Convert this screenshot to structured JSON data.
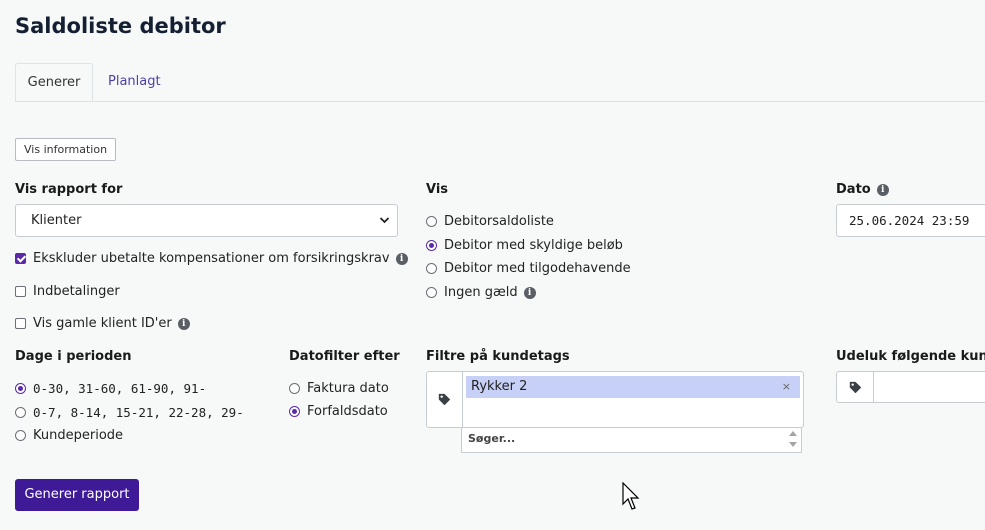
{
  "page": {
    "title": "Saldoliste debitor"
  },
  "tabs": [
    {
      "label": "Generer",
      "active": true
    },
    {
      "label": "Planlagt",
      "active": false
    }
  ],
  "info_button": {
    "label": "Vis information"
  },
  "report_for": {
    "label": "Vis rapport for",
    "selected": "Klienter",
    "options": [
      {
        "label": "Ekskluder ubetalte kompensationer om forsikringskrav",
        "checked": true,
        "info": true
      },
      {
        "label": "Indbetalinger",
        "checked": false,
        "info": false
      },
      {
        "label": "Vis gamle klient ID'er",
        "checked": false,
        "info": true
      }
    ]
  },
  "vis": {
    "label": "Vis",
    "options": [
      {
        "label": "Debitorsaldoliste",
        "checked": false,
        "info": false
      },
      {
        "label": "Debitor med skyldige beløb",
        "checked": true,
        "info": false
      },
      {
        "label": "Debitor med tilgodehavende",
        "checked": false,
        "info": false
      },
      {
        "label": "Ingen gæld",
        "checked": false,
        "info": true
      }
    ]
  },
  "dato": {
    "label": "Dato",
    "value": "25.06.2024 23:59"
  },
  "dage": {
    "label": "Dage i perioden",
    "options": [
      {
        "label": "0-30, 31-60, 61-90, 91-",
        "checked": true
      },
      {
        "label": "0-7, 8-14, 15-21, 22-28, 29-",
        "checked": false
      },
      {
        "label": "Kundeperiode",
        "checked": false
      }
    ]
  },
  "datofilter": {
    "label": "Datofilter efter",
    "options": [
      {
        "label": "Faktura dato",
        "checked": false
      },
      {
        "label": "Forfaldsdato",
        "checked": true
      }
    ]
  },
  "kundetags": {
    "label": "Filtre på kundetags",
    "selected_tag": "Rykker 2",
    "remove_symbol": "×",
    "search_placeholder": "Søger..."
  },
  "udeluk": {
    "label": "Udeluk følgende kundet"
  },
  "submit": {
    "label": "Generer rapport"
  },
  "icons": {
    "info": "info-icon",
    "tag": "tag-icon",
    "chevron": "chevron-down-icon",
    "cursor": "mouse-cursor-icon"
  },
  "colors": {
    "accent": "#5b2aa8",
    "primary_button": "#3f1a97",
    "tag_chip": "#c7d0f7",
    "link": "#4b3fa8"
  }
}
